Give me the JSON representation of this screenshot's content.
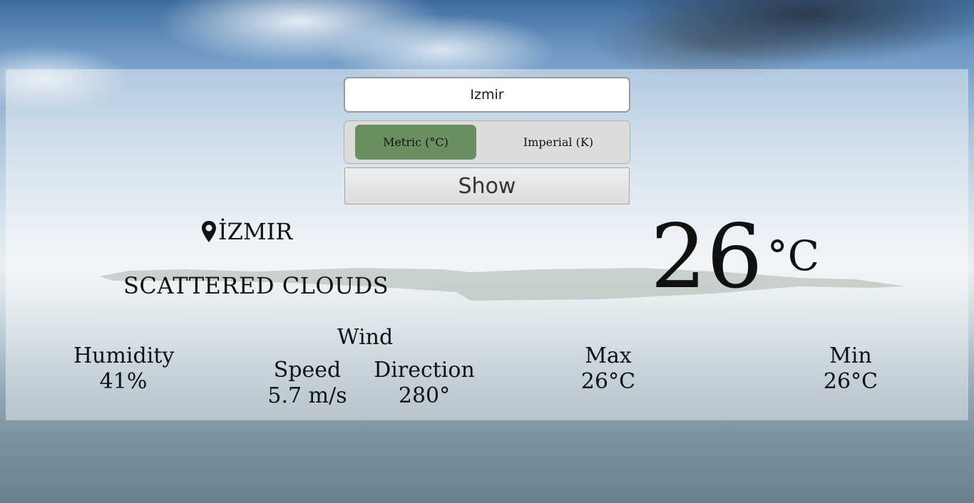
{
  "search": {
    "value": "Izmir"
  },
  "units": {
    "metric_label": "Metric (°C)",
    "imperial_label": "Imperial (K)",
    "selected": "metric",
    "selected_color": "#6b8f63"
  },
  "show_button": {
    "label": "Show"
  },
  "weather": {
    "city": "İZMIR",
    "condition": "SCATTERED CLOUDS",
    "temperature": "26",
    "temperature_unit": "°C",
    "humidity": {
      "label": "Humidity",
      "value": "41%"
    },
    "wind": {
      "title": "Wind",
      "speed": {
        "label": "Speed",
        "value": "5.7 m/s"
      },
      "direction": {
        "label": "Direction",
        "value": "280°"
      }
    },
    "max": {
      "label": "Max",
      "value": "26°C"
    },
    "min": {
      "label": "Min",
      "value": "26°C"
    }
  },
  "icons": {
    "location": "map-pin-icon"
  }
}
